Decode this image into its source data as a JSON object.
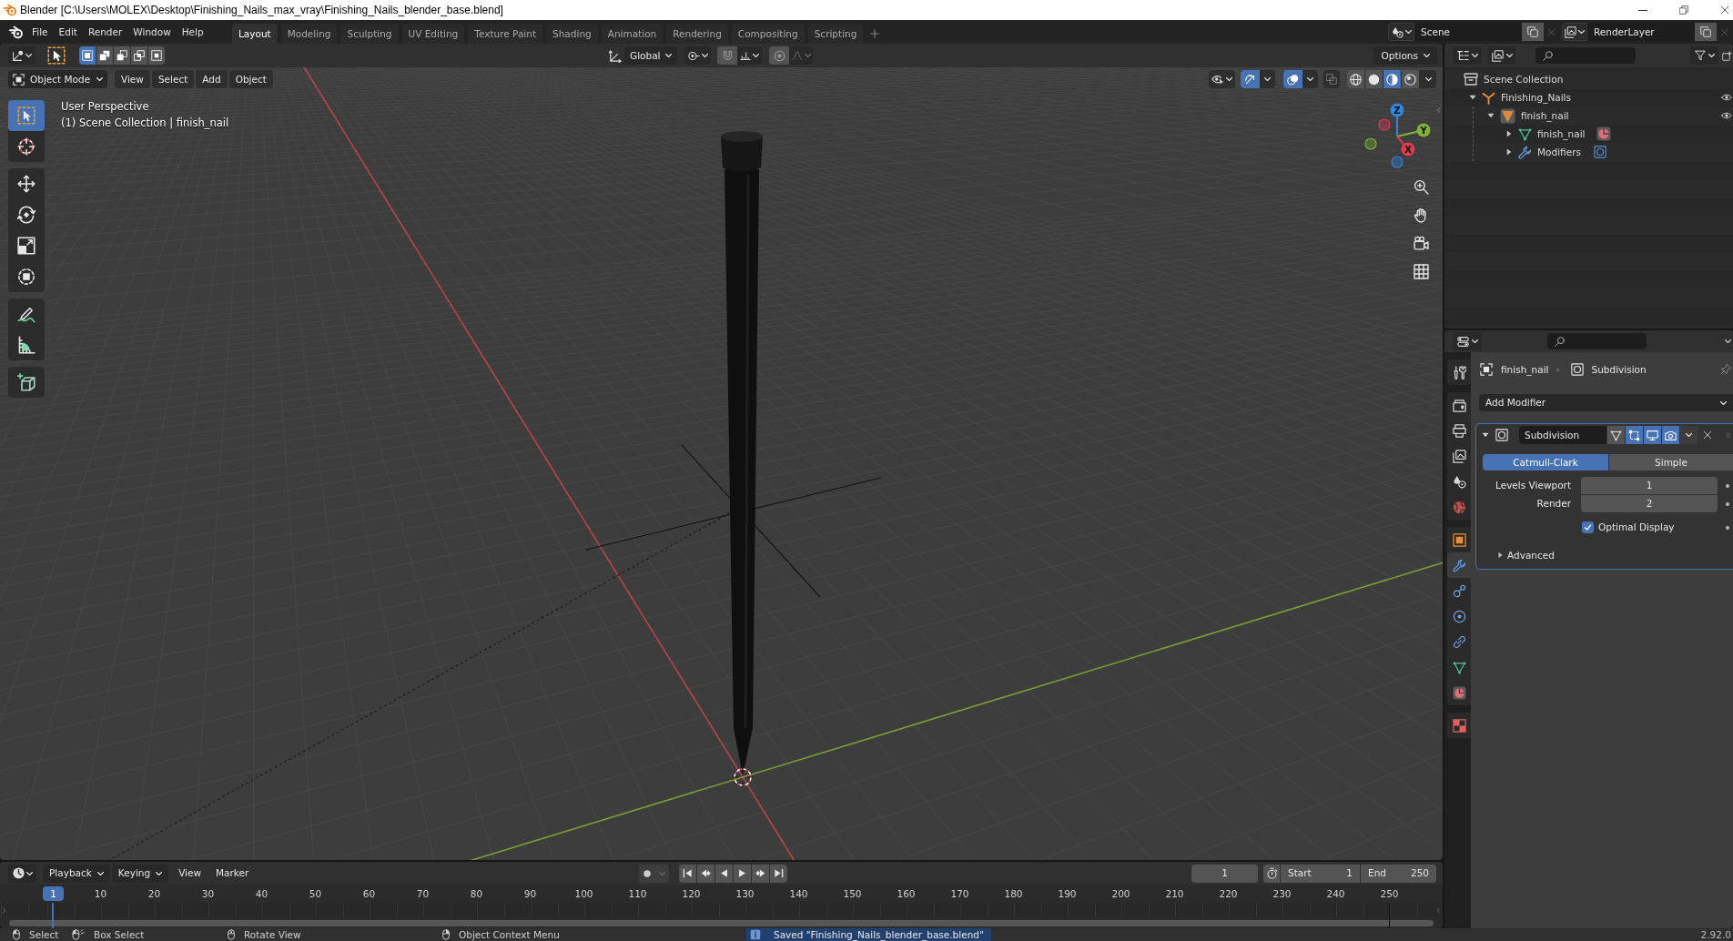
{
  "window": {
    "title": "Blender [C:\\Users\\MOLEX\\Desktop\\Finishing_Nails_max_vray\\Finishing_Nails_blender_base.blend]"
  },
  "topbar": {
    "menus": [
      "File",
      "Edit",
      "Render",
      "Window",
      "Help"
    ],
    "workspaces": [
      {
        "label": "Layout",
        "selected": true
      },
      {
        "label": "Modeling",
        "selected": false
      },
      {
        "label": "Sculpting",
        "selected": false
      },
      {
        "label": "UV Editing",
        "selected": false
      },
      {
        "label": "Texture Paint",
        "selected": false
      },
      {
        "label": "Shading",
        "selected": false
      },
      {
        "label": "Animation",
        "selected": false
      },
      {
        "label": "Rendering",
        "selected": false
      },
      {
        "label": "Compositing",
        "selected": false
      },
      {
        "label": "Scripting",
        "selected": false
      }
    ],
    "scene": "Scene",
    "view_layer": "RenderLayer"
  },
  "viewport": {
    "tool_header": {
      "select_modes": [
        {
          "selected": true
        },
        {
          "selected": false
        },
        {
          "selected": false
        },
        {
          "selected": false
        },
        {
          "selected": false
        }
      ],
      "orientation": "Global",
      "snap": {
        "on": false
      },
      "proportional_editing": {
        "on": false
      },
      "options": "Options"
    },
    "header": {
      "mode": "Object Mode",
      "menus": [
        "View",
        "Select",
        "Add",
        "Object"
      ],
      "gizmos": {
        "on": true
      },
      "overlays": {
        "on": true
      },
      "xray": {
        "on": false
      },
      "shading": [
        {
          "kind": "wireframe",
          "selected": false
        },
        {
          "kind": "solid",
          "selected": false
        },
        {
          "kind": "material",
          "selected": true
        },
        {
          "kind": "rendered",
          "selected": false
        }
      ]
    },
    "tool_groups": [
      {
        "tools": [
          {
            "kind": "select_box",
            "selected": true
          },
          {
            "kind": "cursor",
            "selected": false
          }
        ]
      },
      {
        "tools": [
          {
            "kind": "move",
            "selected": false
          },
          {
            "kind": "rotate",
            "selected": false
          },
          {
            "kind": "scale",
            "selected": false
          },
          {
            "kind": "transform",
            "selected": false
          }
        ]
      },
      {
        "tools": [
          {
            "kind": "annotate",
            "selected": false
          },
          {
            "kind": "measure",
            "selected": false
          }
        ]
      },
      {
        "tools": [
          {
            "kind": "add_cube",
            "selected": false
          }
        ]
      }
    ],
    "info": [
      "User Perspective",
      "(1) Scene Collection | finish_nail"
    ],
    "gizmo_axes": [
      {
        "label": "Z",
        "color": "#2f86e0"
      },
      {
        "label": "Y",
        "color": "#7fb236"
      },
      {
        "label": "X",
        "color": "#dc3b50"
      }
    ]
  },
  "outliner": {
    "tree": [
      {
        "label": "Scene Collection",
        "kind": "scene_collection",
        "children": [
          {
            "label": "Finishing_Nails",
            "kind": "empty",
            "expanded": true,
            "children": [
              {
                "label": "finish_nail",
                "kind": "mesh_object",
                "expanded": true,
                "children": [
                  {
                    "label": "finish_nail",
                    "kind": "mesh_data",
                    "expanded": false
                  },
                  {
                    "label": "Modifiers",
                    "kind": "modifiers",
                    "expanded": false
                  }
                ]
              }
            ]
          }
        ]
      }
    ]
  },
  "properties": {
    "tab_groups": [
      {
        "tabs": [
          {
            "kind": "tool",
            "selected": false
          }
        ]
      },
      {
        "tabs": [
          {
            "kind": "render",
            "selected": false
          },
          {
            "kind": "output",
            "selected": false
          },
          {
            "kind": "view_layer",
            "selected": false
          },
          {
            "kind": "scene",
            "selected": false
          },
          {
            "kind": "world",
            "selected": false
          }
        ]
      },
      {
        "tabs": [
          {
            "kind": "object",
            "selected": false
          },
          {
            "kind": "modifiers",
            "selected": true
          },
          {
            "kind": "particles",
            "selected": false
          },
          {
            "kind": "physics",
            "selected": false
          },
          {
            "kind": "constraints",
            "selected": false
          },
          {
            "kind": "data",
            "selected": false
          },
          {
            "kind": "material",
            "selected": false
          }
        ]
      },
      {
        "tabs": [
          {
            "kind": "texture",
            "selected": false
          }
        ]
      }
    ],
    "breadcrumb": [
      "finish_nail",
      "Subdivision"
    ],
    "add_modifier": "Add Modifier",
    "modifier": {
      "name": "Subdivision",
      "expanded": true,
      "toggles": [
        {
          "kind": "edit_cage",
          "on": false
        },
        {
          "kind": "edit_mode",
          "on": true
        },
        {
          "kind": "viewport",
          "on": true
        },
        {
          "kind": "render",
          "on": true
        }
      ],
      "types": [
        {
          "label": "Catmull-Clark",
          "selected": true
        },
        {
          "label": "Simple",
          "selected": false
        }
      ],
      "levels": [
        {
          "label": "Levels Viewport",
          "value": "1"
        },
        {
          "label": "Render",
          "value": "2"
        }
      ],
      "optimal_display": {
        "label": "Optimal Display",
        "checked": true
      },
      "advanced": {
        "label": "Advanced",
        "expanded": false
      }
    }
  },
  "timeline": {
    "menus": [
      {
        "label": "Playback",
        "kind": "dropdown"
      },
      {
        "label": "Keying",
        "kind": "dropdown"
      },
      {
        "label": "View",
        "kind": "plain"
      },
      {
        "label": "Marker",
        "kind": "plain"
      }
    ],
    "auto_keying": {
      "on": false
    },
    "current_frame": "1",
    "start": {
      "label": "Start",
      "value": "1"
    },
    "end": {
      "label": "End",
      "value": "250"
    },
    "playhead": "1",
    "frame_labels": [
      "10",
      "20",
      "30",
      "40",
      "50",
      "60",
      "70",
      "80",
      "90",
      "100",
      "110",
      "120",
      "130",
      "140",
      "150",
      "160",
      "170",
      "180",
      "190",
      "200",
      "210",
      "220",
      "230",
      "240",
      "250"
    ]
  },
  "status_bar": {
    "hints": [
      {
        "kind": "left_click",
        "label": "Select"
      },
      {
        "kind": "drag",
        "label": "Box Select"
      },
      {
        "kind": "middle_click",
        "label": "Rotate View"
      },
      {
        "kind": "right_click",
        "label": "Object Context Menu"
      }
    ],
    "message": "Saved \"Finishing_Nails_blender_base.blend\"",
    "version": "2.92.0"
  }
}
